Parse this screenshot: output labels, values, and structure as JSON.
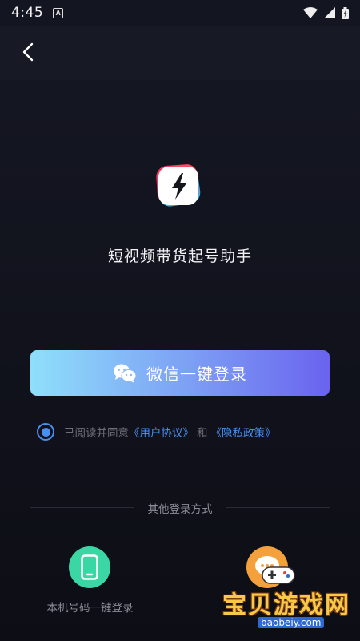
{
  "status_bar": {
    "time": "4:45",
    "notification_icon": "A"
  },
  "app_bar": {
    "back_icon": "chevron-left-icon"
  },
  "app": {
    "name": "短视频带货起号助手",
    "logo_icon": "lightning-play-icon"
  },
  "login": {
    "wechat_button_label": "微信一键登录",
    "agreement": {
      "checked": true,
      "prefix": "已阅读并同意",
      "user_agreement": "《用户协议》",
      "and": "和",
      "privacy_policy": "《隐私政策》"
    },
    "other_methods_title": "其他登录方式",
    "phone_login_label": "本机号码一键登录"
  },
  "watermark": {
    "text": "宝贝游戏网",
    "domain": "baobeiy.com"
  },
  "colors": {
    "accent": "#4a8ff0",
    "phone_option": "#3ad6a4",
    "qq_option": "#f4a13d"
  }
}
